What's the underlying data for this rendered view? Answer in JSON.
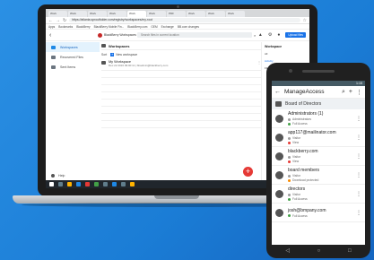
{
  "browser": {
    "tabs": [
      "Work",
      "Work",
      "Work",
      "Work",
      "Work",
      "Work",
      "PDF",
      "Work",
      "Work",
      "Work"
    ],
    "url": "https://atlanta.sproutfolder.com/registry/workspaces/my-root",
    "bookmarks": [
      "Apps",
      "Bookmarks",
      "BlackBerry",
      "BlackBerry Mobile Fin...",
      "BlackBerry.com",
      "GEM",
      "Exchange",
      "BB.com changes"
    ]
  },
  "app": {
    "user": "BlackBerry Workspaces",
    "search_placeholder": "Search files in current location",
    "upload_label": "Upload files",
    "sidebar": [
      "Workspaces",
      "Recovered Files",
      "Sent Items"
    ],
    "help_label": "Help",
    "section_title": "Workspaces",
    "sort_label": "Sort",
    "new_label": "New workspace",
    "workspace": {
      "name": "My Workspace",
      "meta": "Dec 22 2016 09:00:11 | bbadmin@blackberry.com"
    },
    "right_panel": {
      "title": "Workspace",
      "tabs": [
        "All",
        "Activity",
        "Files"
      ]
    }
  },
  "phone": {
    "status_left": "",
    "status_right": "1:15",
    "title": "ManageAccess",
    "subheader": "Board of Directors",
    "members": [
      {
        "name": "Administrators (1)",
        "line1": "Administrators",
        "line2": "Full Access",
        "color1": "#9e9e9e",
        "color2": "#43a047"
      },
      {
        "name": "app117@mailinator.com",
        "line1": "Visitor",
        "line2": "View",
        "color1": "#9e9e9e",
        "color2": "#e53935"
      },
      {
        "name": "blackberry.com",
        "line1": "Visitor",
        "line2": "View",
        "color1": "#9e9e9e",
        "color2": "#e53935"
      },
      {
        "name": "board members",
        "line1": "Visitor",
        "line2": "Download protected",
        "color1": "#9e9e9e",
        "color2": "#fb8c00"
      },
      {
        "name": "directors",
        "line1": "Visitor",
        "line2": "Full Access",
        "color1": "#9e9e9e",
        "color2": "#43a047"
      },
      {
        "name": "josh@bmpany.com",
        "line1": "Full Access",
        "line2": "",
        "color1": "#43a047",
        "color2": ""
      }
    ]
  }
}
